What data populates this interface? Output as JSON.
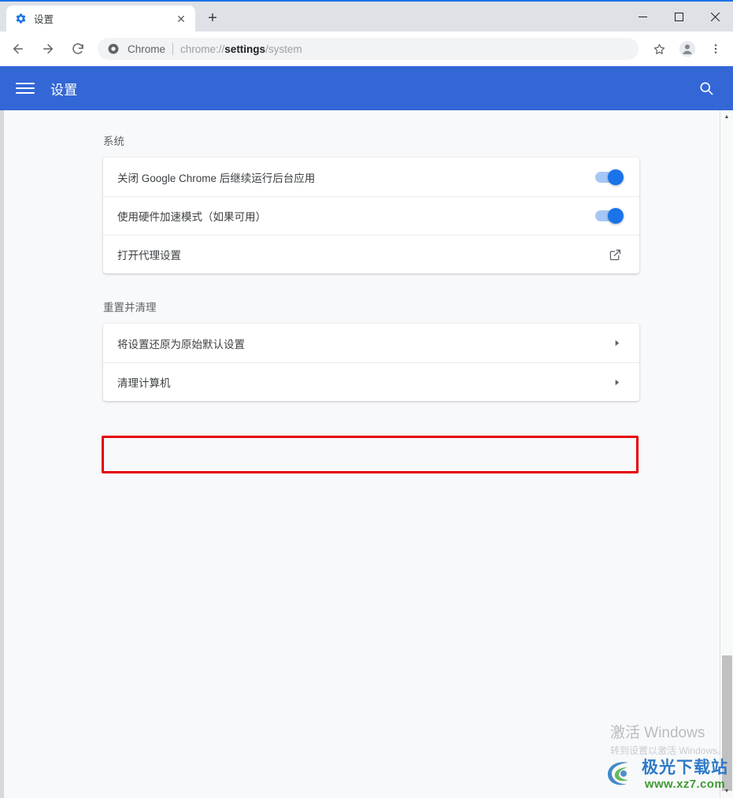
{
  "window": {
    "minimize_label": "—",
    "maximize_label": "□",
    "close_label": "✕"
  },
  "tabs": [
    {
      "title": "设置",
      "favicon": "gear-icon",
      "close_label": "✕"
    }
  ],
  "newtab_label": "+",
  "toolbar": {
    "back_label": "←",
    "forward_label": "→",
    "reload_label": "⟳",
    "omnibox": {
      "chip": "Chrome",
      "url_prefix": "chrome://",
      "url_bold": "settings",
      "url_suffix": "/system",
      "icon": "chrome-icon"
    },
    "bookmark_icon": "star-icon",
    "profile_icon": "avatar-icon",
    "menu_icon": "three-dot-menu-icon"
  },
  "settings_header": {
    "title": "设置",
    "menu_icon": "hamburger-icon",
    "search_icon": "search-icon",
    "bg_color": "#3367d6"
  },
  "sections": [
    {
      "heading": "系统",
      "rows": [
        {
          "label": "关闭 Google Chrome 后继续运行后台应用",
          "control": "toggle",
          "toggle_on": true,
          "name": "background-apps-row"
        },
        {
          "label": "使用硬件加速模式（如果可用）",
          "control": "toggle",
          "toggle_on": true,
          "name": "hardware-acceleration-row"
        },
        {
          "label": "打开代理设置",
          "control": "external-link",
          "name": "proxy-settings-row"
        }
      ]
    },
    {
      "heading": "重置并清理",
      "rows": [
        {
          "label": "将设置还原为原始默认设置",
          "control": "arrow",
          "highlighted": true,
          "name": "restore-defaults-row"
        },
        {
          "label": "清理计算机",
          "control": "arrow",
          "name": "cleanup-computer-row"
        }
      ]
    }
  ],
  "highlight": {
    "color": "#e60000"
  },
  "scrollbar": {
    "up_arrow": "▲",
    "down_arrow": "▼"
  },
  "watermarks": {
    "windows_line1": "激活 Windows",
    "windows_line2": "转到设置以激活 Windows。",
    "site_cn": "极光下载站",
    "site_url": "www.xz7.com"
  }
}
